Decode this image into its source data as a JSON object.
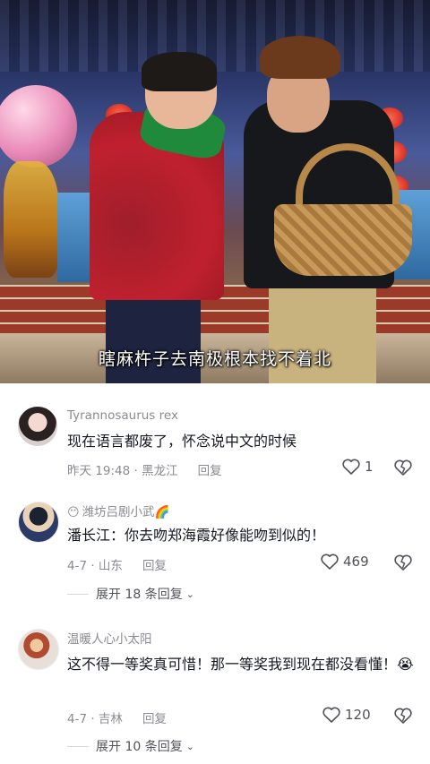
{
  "video": {
    "subtitle": "瞎麻杵子去南极根本找不着北"
  },
  "comments": [
    {
      "username": "Tyrannosaurus rex",
      "badge": "",
      "text": "现在语言都废了，怀念说中文的时候",
      "time_location": "昨天 19:48 · 黑龙江",
      "reply_label": "回复",
      "likes": "1",
      "expand": ""
    },
    {
      "username": "潍坊吕剧小武🌈",
      "badge": "😶",
      "text": "潘长江：你去吻郑海霞好像能吻到似的！",
      "time_location": "4-7 · 山东",
      "reply_label": "回复",
      "likes": "469",
      "expand": "展开 18 条回复"
    },
    {
      "username": "温暖人心小太阳",
      "badge": "",
      "text": "这不得一等奖真可惜！那一等奖我到现在都没看懂！😭",
      "time_location": "4-7 · 吉林",
      "reply_label": "回复",
      "likes": "120",
      "expand": "展开 10 条回复"
    }
  ],
  "colors": {
    "text_primary": "#161823",
    "text_secondary": "#8a8b91",
    "background": "#ffffff"
  }
}
